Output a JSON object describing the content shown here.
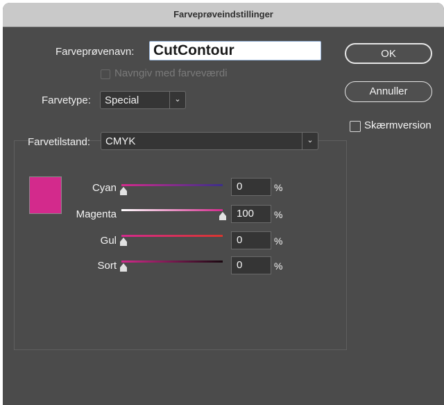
{
  "window": {
    "title": "Farveprøveindstillinger"
  },
  "form": {
    "name_label": "Farveprøvenavn:",
    "name_value": "CutContour",
    "name_with_value_label": "Navngiv med farveværdi",
    "colortype_label": "Farvetype:",
    "colortype_value": "Special",
    "colormode_label": "Farvetilstand:",
    "colormode_value": "CMYK"
  },
  "buttons": {
    "ok": "OK",
    "cancel": "Annuller"
  },
  "preview": {
    "label": "Skærmversion",
    "checked": false
  },
  "swatch_color": "#d32a8c",
  "sliders": [
    {
      "label": "Cyan",
      "value": "0",
      "unit": "%",
      "fraction": 0.0
    },
    {
      "label": "Magenta",
      "value": "100",
      "unit": "%",
      "fraction": 1.0
    },
    {
      "label": "Gul",
      "value": "0",
      "unit": "%",
      "fraction": 0.0
    },
    {
      "label": "Sort",
      "value": "0",
      "unit": "%",
      "fraction": 0.0
    }
  ]
}
